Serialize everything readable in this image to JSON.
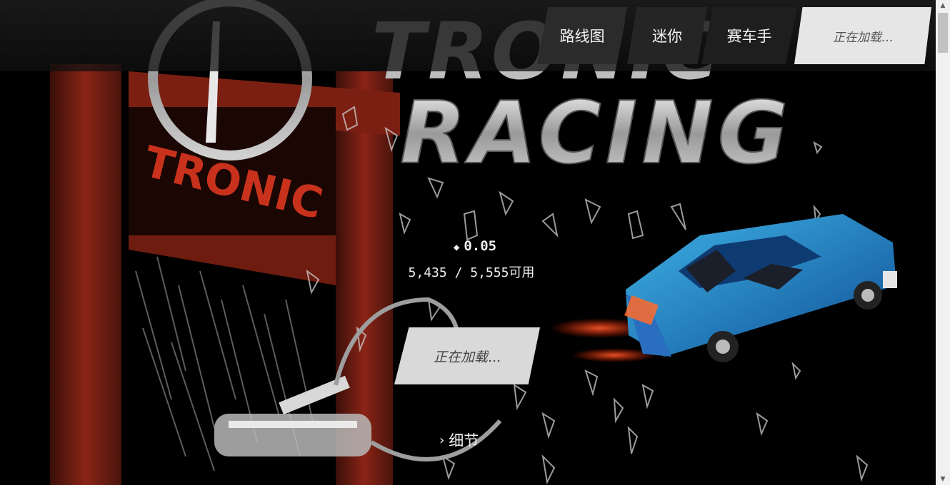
{
  "nav": {
    "roadmap": "路线图",
    "mini": "迷你",
    "drivers": "赛车手",
    "loading": "正在加载..."
  },
  "hero": {
    "logo_word_1": "TRONIC",
    "logo_word_2": "RACING"
  },
  "mint": {
    "price_icon": "eth-diamond-icon",
    "price": "0.05",
    "supply": "5,435 / 5,555可用",
    "button": "正在加载..."
  },
  "details": {
    "icon": "chevron-right-icon",
    "label": "细节"
  },
  "colors": {
    "background": "#000000",
    "frame_red": "#8a2416",
    "car_blue": "#1f79c9",
    "button_light": "#d9d9d9",
    "nav_dark": "#2b2b2b"
  }
}
